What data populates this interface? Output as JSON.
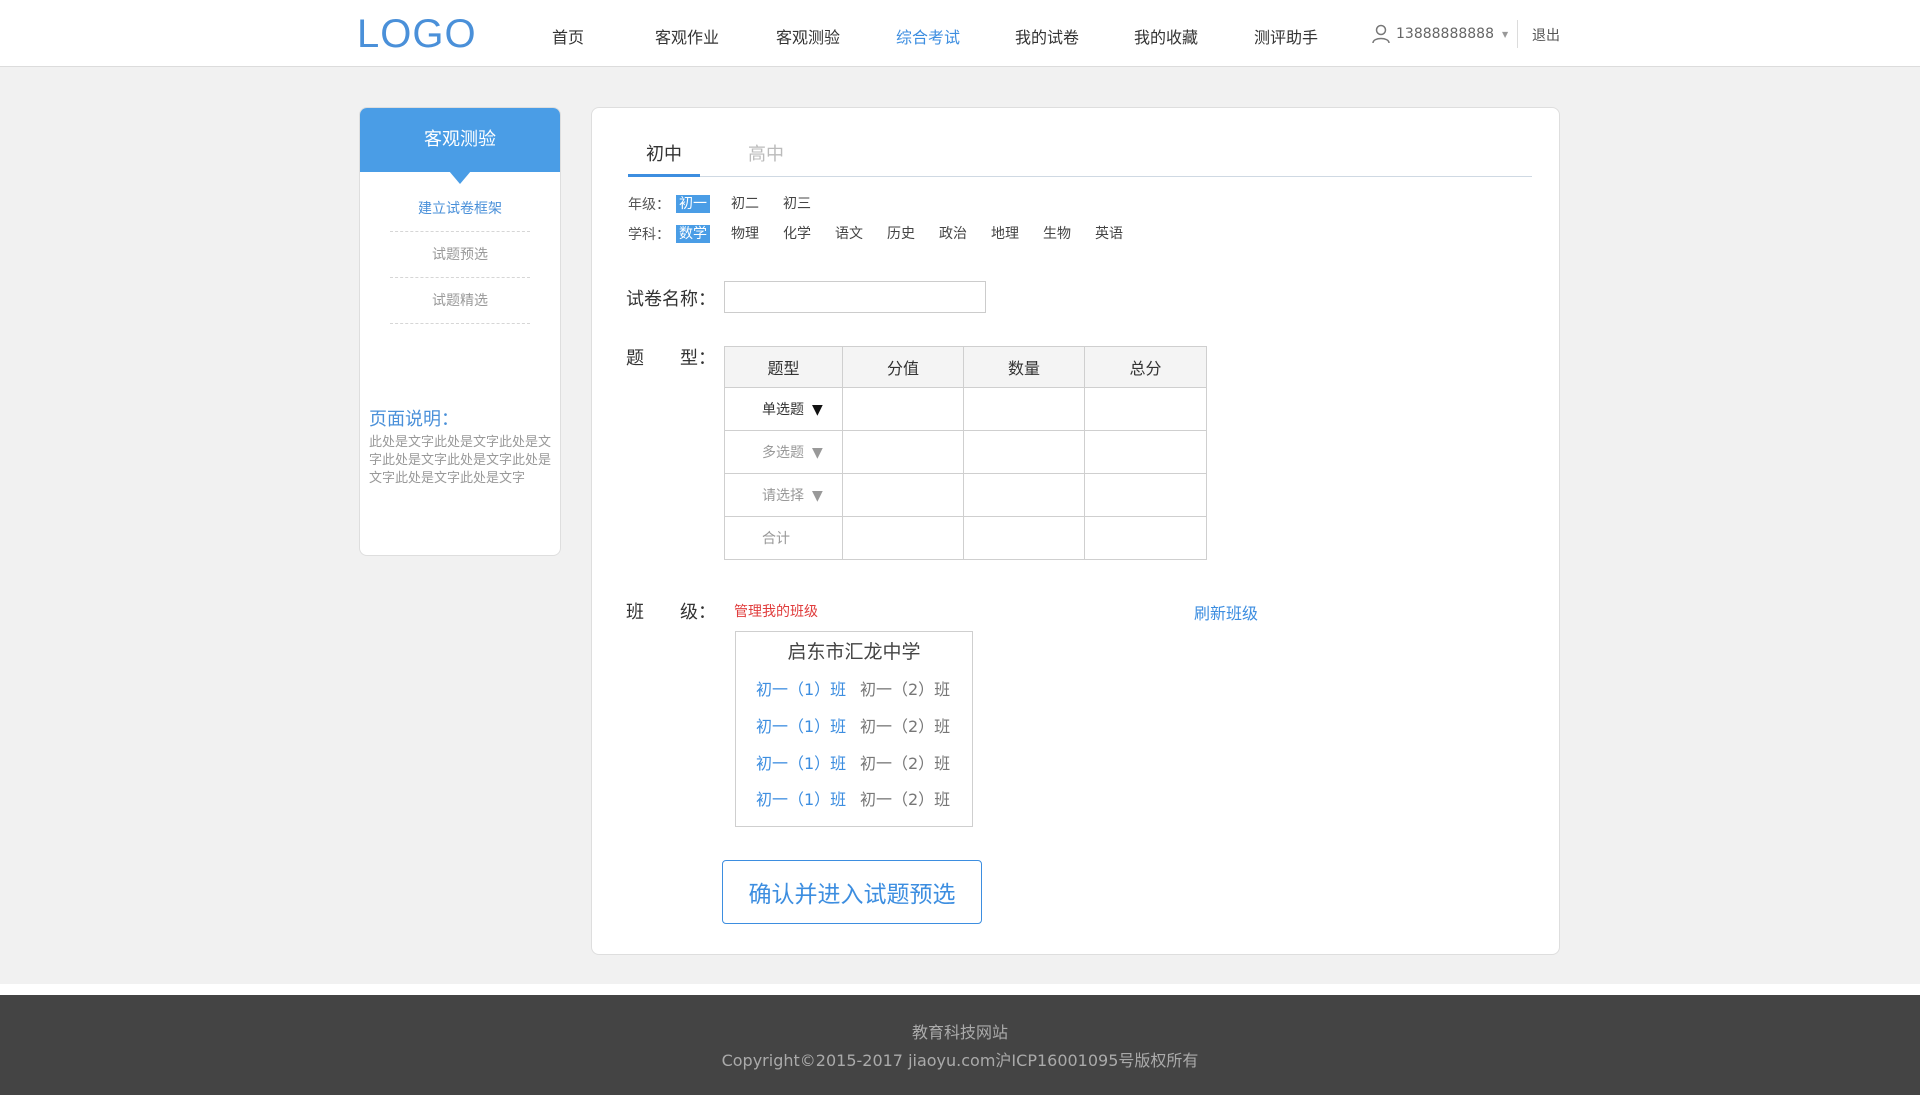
{
  "header": {
    "logo": "LOGO",
    "nav": [
      {
        "label": "首页"
      },
      {
        "label": "客观作业"
      },
      {
        "label": "客观测验"
      },
      {
        "label": "综合考试"
      },
      {
        "label": "我的试卷"
      },
      {
        "label": "我的收藏"
      },
      {
        "label": "测评助手"
      }
    ],
    "active_nav": "综合考试",
    "user": "13888888888",
    "logout": "退出"
  },
  "sidebar": {
    "title": "客观测验",
    "items": [
      {
        "label": "建立试卷框架"
      },
      {
        "label": "试题预选"
      },
      {
        "label": "试题精选"
      }
    ],
    "desc_title": "页面说明：",
    "desc_text": "此处是文字此处是文字此处是文字此处是文字此处是文字此处是文字此处是文字此处是文字"
  },
  "main": {
    "tabs": [
      {
        "label": "初中"
      },
      {
        "label": "高中"
      }
    ],
    "grade_label": "年级：",
    "grades": [
      "初一",
      "初二",
      "初三"
    ],
    "subject_label": "学科：",
    "subjects": [
      "数学",
      "物理",
      "化学",
      "语文",
      "历史",
      "政治",
      "地理",
      "生物",
      "英语"
    ],
    "paper_name_label": "试卷名称：",
    "paper_name_value": "",
    "question_type_label": "题　　型：",
    "table": {
      "headers": [
        "题型",
        "分值",
        "数量",
        "总分"
      ],
      "rows": [
        {
          "type": "单选题",
          "dropdown": true
        },
        {
          "type": "多选题",
          "dropdown": true
        },
        {
          "type": "请选择",
          "dropdown": true
        },
        {
          "type": "合计",
          "dropdown": false
        }
      ]
    },
    "class_label": "班　　级：",
    "manage_link": "管理我的班级",
    "refresh_link": "刷新班级",
    "school": "启东市汇龙中学",
    "classes": [
      [
        "初一（1）班",
        "初一（2）班"
      ],
      [
        "初一（1）班",
        "初一（2）班"
      ],
      [
        "初一（1）班",
        "初一（2）班"
      ],
      [
        "初一（1）班",
        "初一（2）班"
      ]
    ],
    "confirm_button": "确认并进入试题预选"
  },
  "footer": {
    "site": "教育科技网站",
    "copyright": "Copyright©2015-2017 jiaoyu.com沪ICP16001095号版权所有"
  },
  "colors": {
    "accent": "#3d8ee0",
    "sidebar_head": "#4a9de6",
    "warning_link": "#e03c3c",
    "footer_bg": "#444444"
  }
}
